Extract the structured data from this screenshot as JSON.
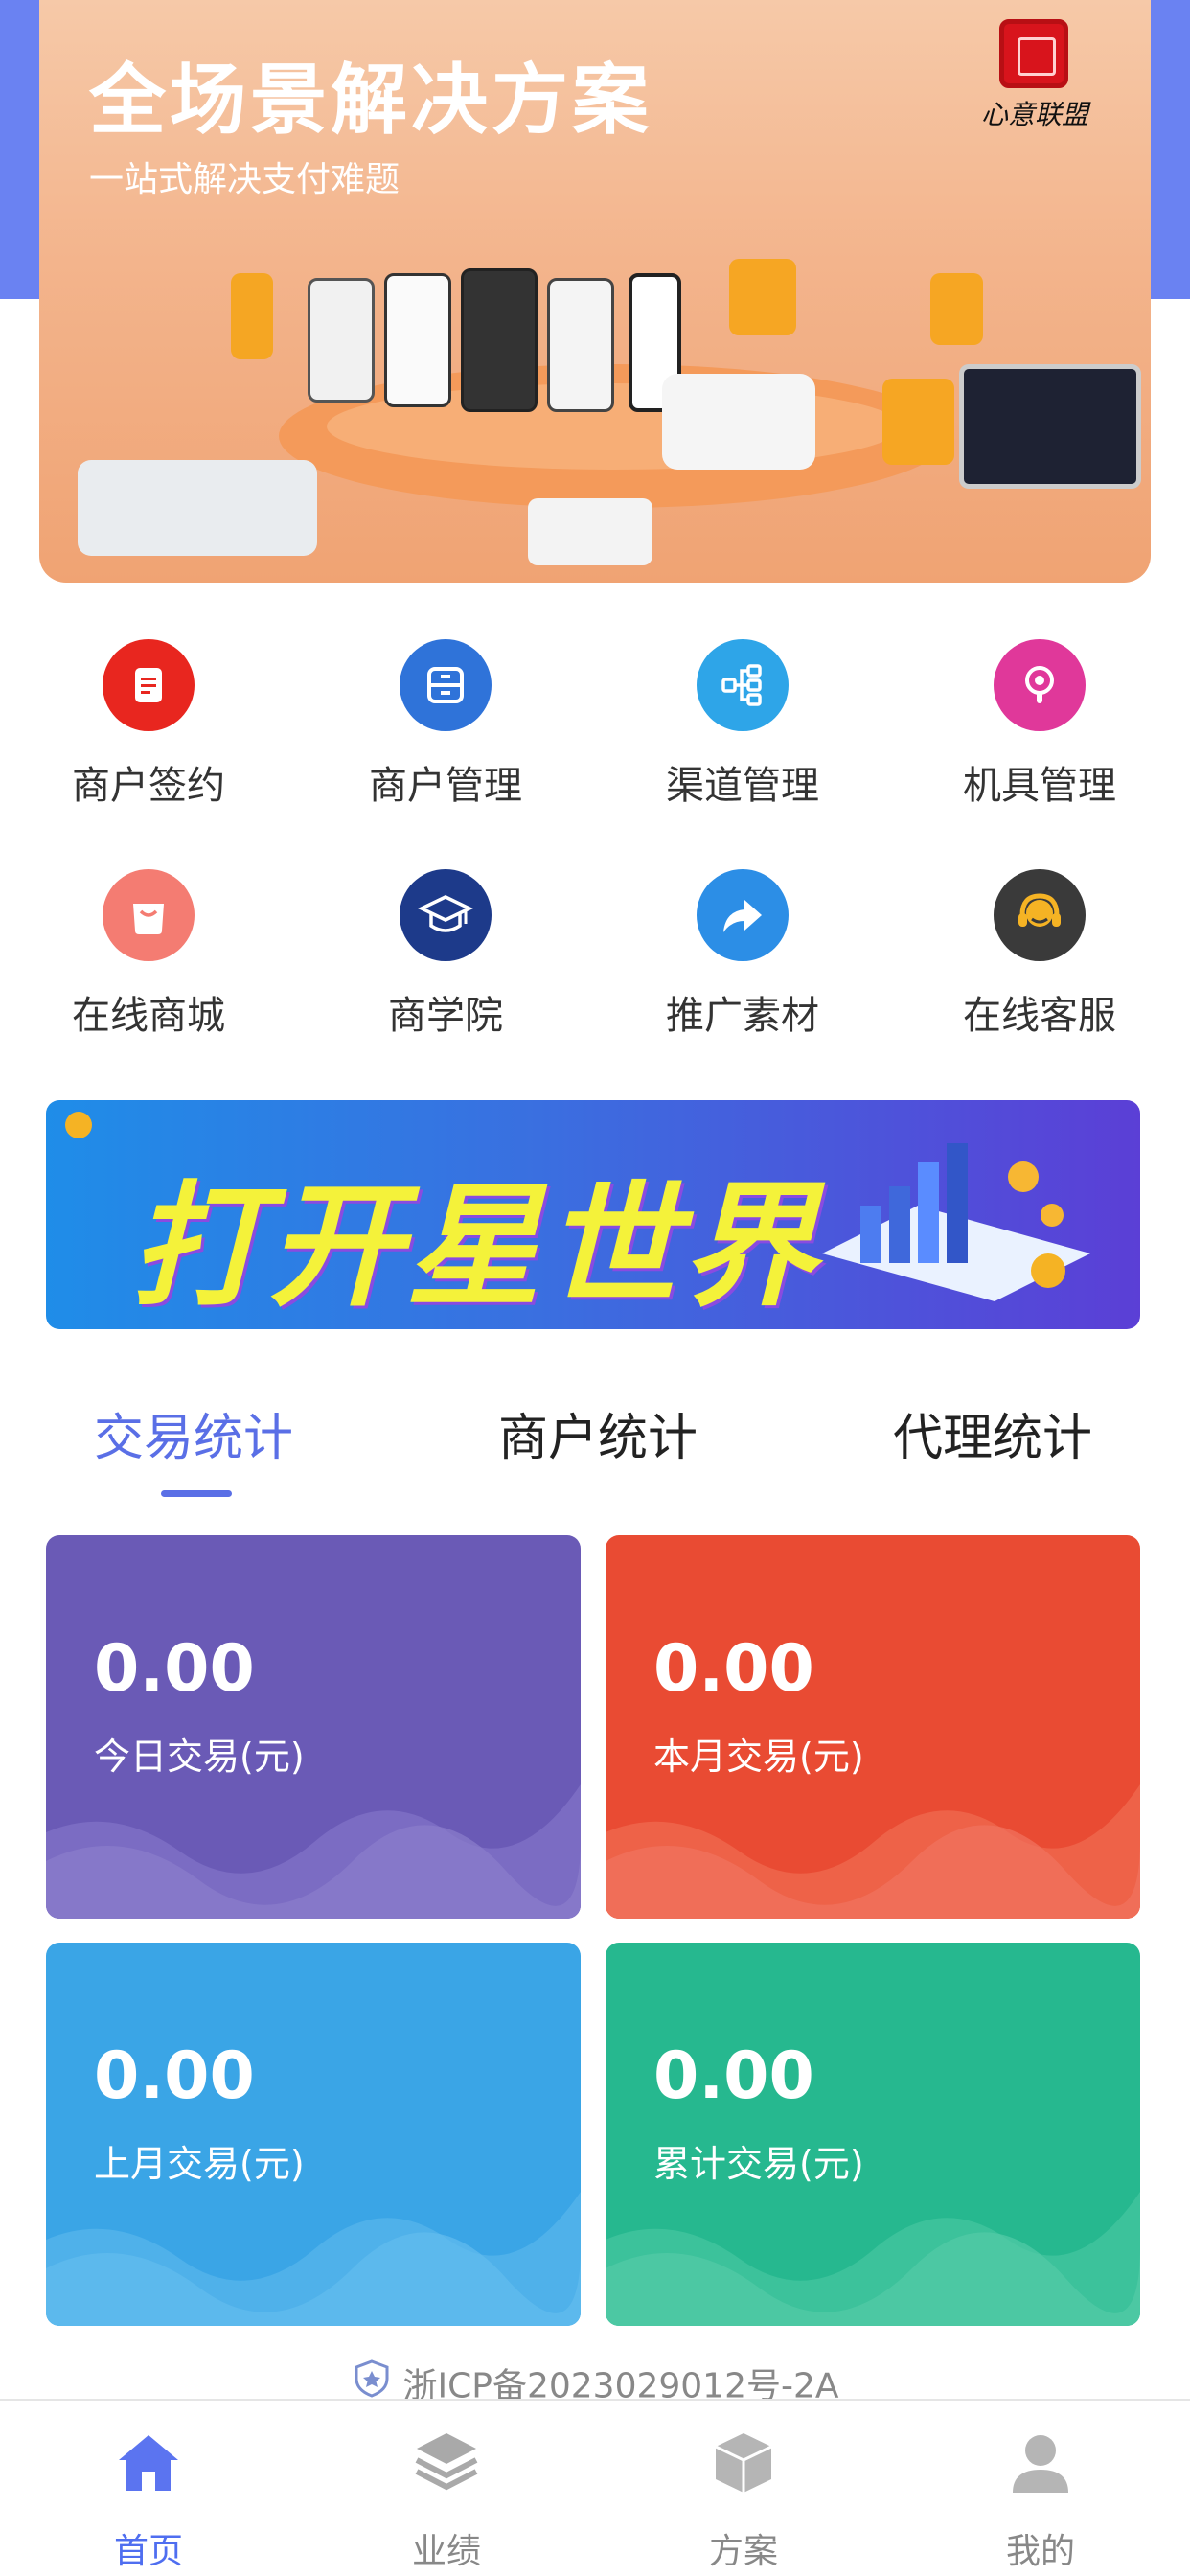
{
  "hero": {
    "title": "全场景解决方案",
    "subtitle": "一站式解决支付难题",
    "logo_text": "心意联盟"
  },
  "menu": [
    {
      "label": "商户签约",
      "icon": "document-icon",
      "color": "#e8261f"
    },
    {
      "label": "商户管理",
      "icon": "archive-box-icon",
      "color": "#2f73d9"
    },
    {
      "label": "渠道管理",
      "icon": "network-icon",
      "color": "#2ea5e8"
    },
    {
      "label": "机具管理",
      "icon": "pos-terminal-icon",
      "color": "#e0389a"
    },
    {
      "label": "在线商城",
      "icon": "shopping-bag-icon",
      "color": "#f47c72"
    },
    {
      "label": "商学院",
      "icon": "graduation-cap-icon",
      "color": "#1d3a8a"
    },
    {
      "label": "推广素材",
      "icon": "share-arrow-icon",
      "color": "#2c8ee6"
    },
    {
      "label": "在线客服",
      "icon": "headset-icon",
      "color": "#3a3a3a"
    }
  ],
  "promo": {
    "text": "打开星世界"
  },
  "tabs": [
    {
      "label": "交易统计",
      "active": true
    },
    {
      "label": "商户统计",
      "active": false
    },
    {
      "label": "代理统计",
      "active": false
    }
  ],
  "stats": [
    {
      "value": "0.00",
      "label": "今日交易(元)",
      "color": "#6a5ab6"
    },
    {
      "value": "0.00",
      "label": "本月交易(元)",
      "color": "#e94b33"
    },
    {
      "value": "0.00",
      "label": "上月交易(元)",
      "color": "#3aa5e6"
    },
    {
      "value": "0.00",
      "label": "累计交易(元)",
      "color": "#26b88f"
    }
  ],
  "icp": "浙ICP备2023029012号-2A",
  "nav": [
    {
      "label": "首页",
      "icon": "home-icon",
      "active": true
    },
    {
      "label": "业绩",
      "icon": "layers-icon",
      "active": false
    },
    {
      "label": "方案",
      "icon": "cube-icon",
      "active": false
    },
    {
      "label": "我的",
      "icon": "user-icon",
      "active": false
    }
  ]
}
